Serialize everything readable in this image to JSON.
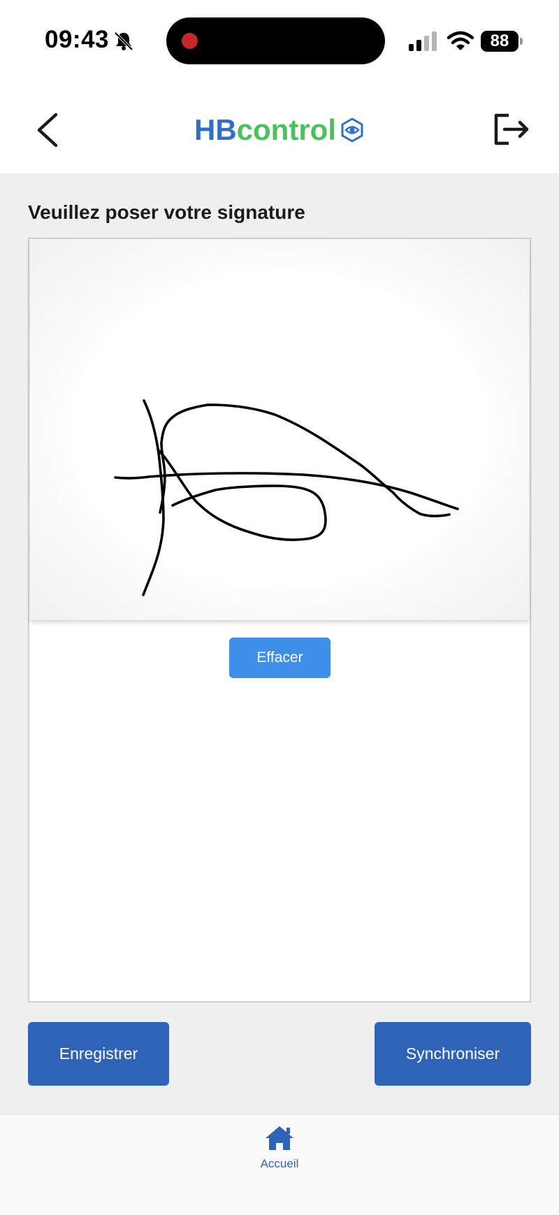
{
  "status_bar": {
    "time": "09:43",
    "battery": "88",
    "icons": [
      "bell-muted-icon",
      "signal-icon",
      "wifi-icon",
      "battery-icon"
    ],
    "recording_color": "#c62828"
  },
  "header": {
    "logo_part1": "HB",
    "logo_part2": "control",
    "logo_color1": "#2f6fc5",
    "logo_color2": "#4cc05a",
    "icons": [
      "back-chevron-icon",
      "logo-eye-icon",
      "logout-icon"
    ]
  },
  "main": {
    "prompt": "Veuillez poser votre signature",
    "clear_label": "Effacer",
    "save_label": "Enregistrer",
    "sync_label": "Synchroniser"
  },
  "colors": {
    "primary": "#2f63b8",
    "clear_button": "#3e8fe8",
    "background": "#efefef"
  },
  "bottom_nav": {
    "items": [
      {
        "label": "Accueil",
        "icon": "home-icon"
      }
    ]
  }
}
